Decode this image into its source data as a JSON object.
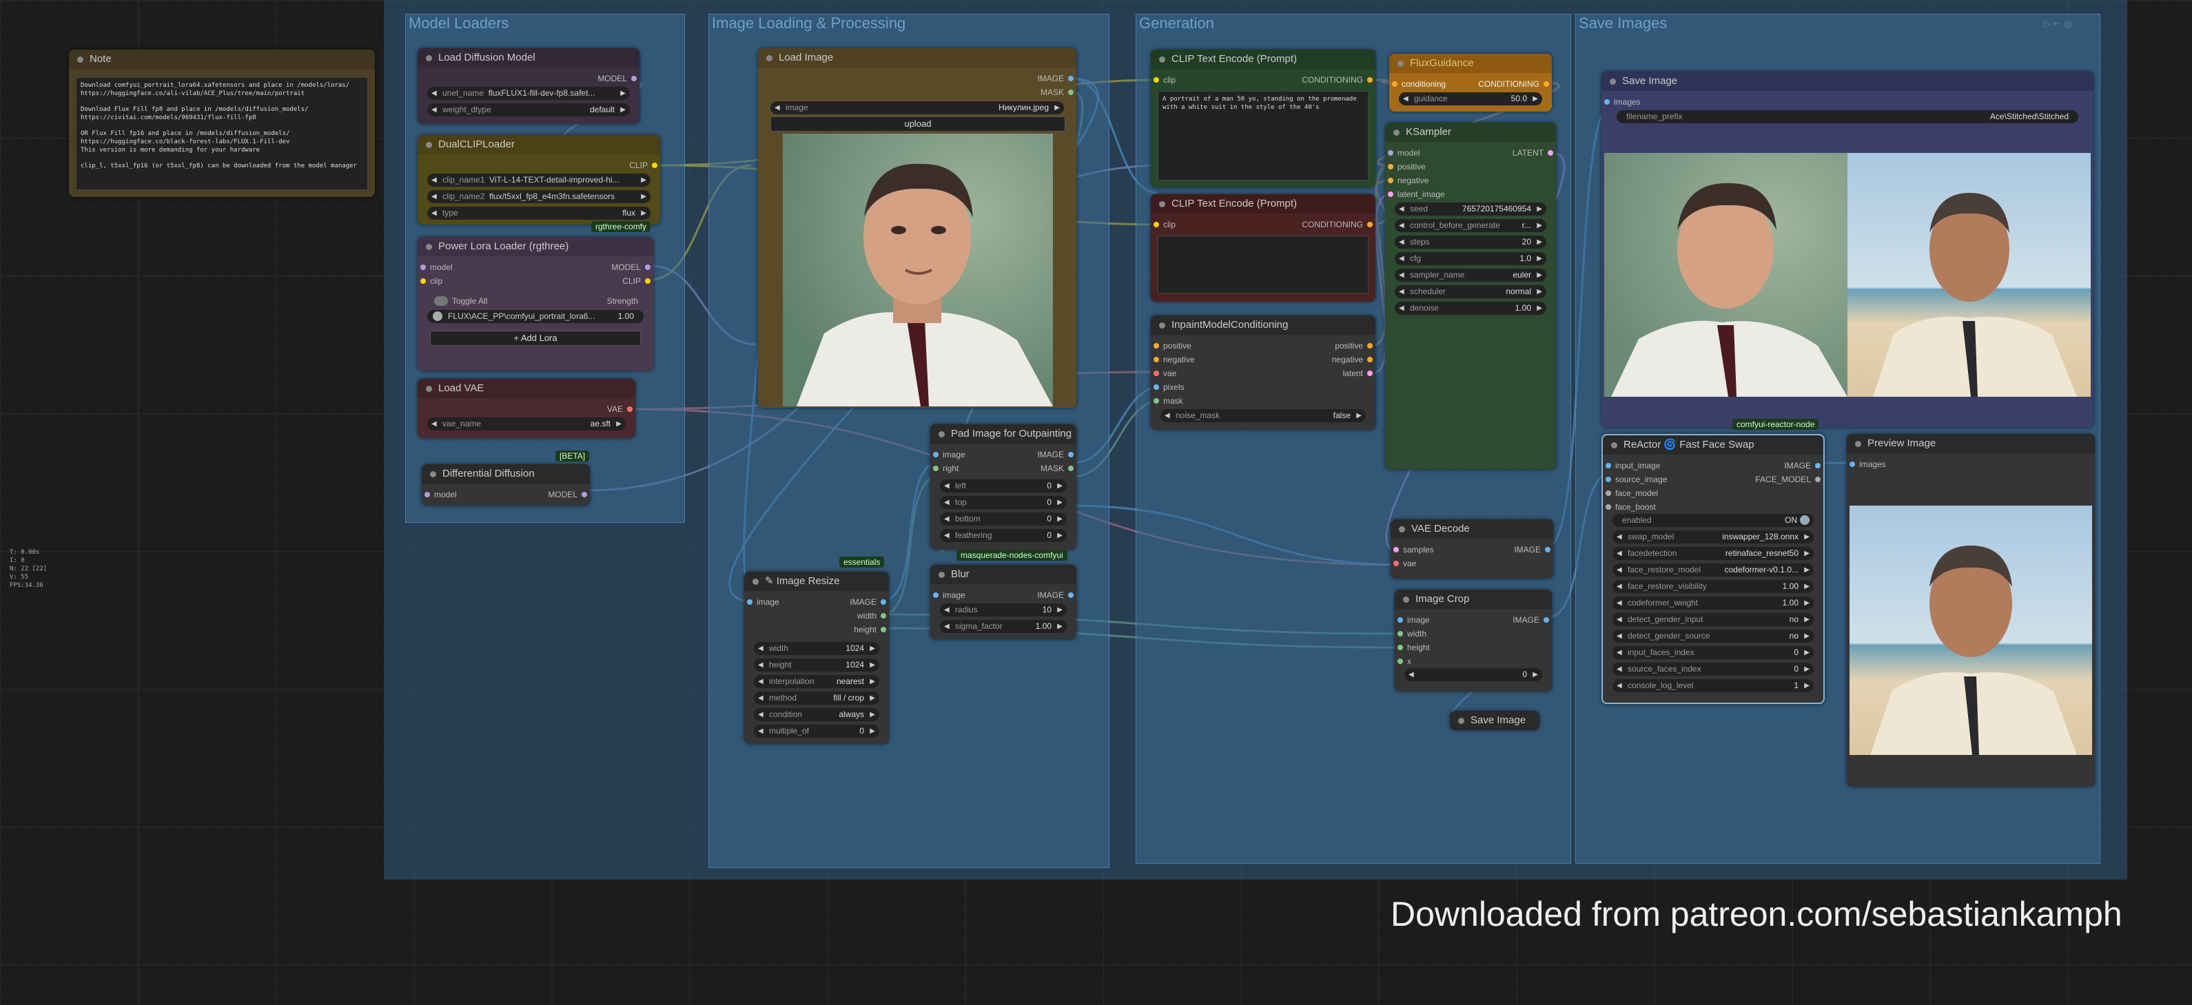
{
  "groups": {
    "model_loaders": "Model Loaders",
    "image_loading": "Image Loading & Processing",
    "generation": "Generation",
    "save_images": "Save Images"
  },
  "note": {
    "title": "Note",
    "text": "Download comfyui_portrait_lora64.safetensors and place in /models/loras/\nhttps://huggingface.co/ali-vilab/ACE_Plus/tree/main/portrait\n\nDownload Flux Fill fp8 and place in /models/diffusion_models/\nhttps://civitai.com/models/969431/flux-fill-fp8\n\nOR Flux Fill fp16 and place in /models/diffusion_models/\nhttps://huggingface.co/black-forest-labs/FLUX.1-Fill-dev\nThis version is more demanding for your hardware\n\nclip_l, t5xxl_fp16 (or t5xxl_fp8) can be downloaded from the model manager"
  },
  "load_diffusion": {
    "title": "Load Diffusion Model",
    "out_model": "MODEL",
    "unet_name_label": "unet_name",
    "unet_name": "fluxFLUX1-fill-dev-fp8.safet...",
    "weight_dtype_label": "weight_dtype",
    "weight_dtype": "default"
  },
  "dual_clip": {
    "title": "DualCLIPLoader",
    "out_clip": "CLIP",
    "clip_name1_label": "clip_name1",
    "clip_name1": "ViT-L-14-TEXT-detail-improved-hi...",
    "clip_name2_label": "clip_name2",
    "clip_name2": "flux/t5xxl_fp8_e4m3fn.safetensors",
    "type_label": "type",
    "type": "flux",
    "tag": "rgthree-comfy"
  },
  "power_lora": {
    "title": "Power Lora Loader (rgthree)",
    "in_model": "model",
    "in_clip": "clip",
    "out_model": "MODEL",
    "out_clip": "CLIP",
    "toggle_all": "Toggle All",
    "strength": "Strength",
    "lora_name": "FLUX\\ACE_PP\\comfyui_portrait_lora6...",
    "lora_strength": "1.00",
    "add_lora": "Add Lora"
  },
  "load_vae": {
    "title": "Load VAE",
    "out_vae": "VAE",
    "vae_name_label": "vae_name",
    "vae_name": "ae.sft"
  },
  "diff_diffusion": {
    "title": "Differential Diffusion",
    "tag": "[BETA]",
    "in_model": "model",
    "out_model": "MODEL"
  },
  "load_image": {
    "title": "Load Image",
    "out_image": "IMAGE",
    "out_mask": "MASK",
    "image_label": "image",
    "image": "Никулин.jpeg",
    "upload": "upload"
  },
  "pad_image": {
    "title": "Pad Image for Outpainting",
    "in_image": "image",
    "in_right": "right",
    "out_image": "IMAGE",
    "out_mask": "MASK",
    "fields": [
      {
        "label": "left",
        "value": "0"
      },
      {
        "label": "top",
        "value": "0"
      },
      {
        "label": "bottom",
        "value": "0"
      },
      {
        "label": "feathering",
        "value": "0"
      }
    ],
    "tag": "masquerade-nodes-comfyui"
  },
  "image_resize": {
    "title": "Image Resize",
    "tag": "essentials",
    "in_image": "image",
    "out_image": "IMAGE",
    "out_width": "width",
    "out_height": "height",
    "fields": [
      {
        "label": "width",
        "value": "1024"
      },
      {
        "label": "height",
        "value": "1024"
      },
      {
        "label": "interpolation",
        "value": "nearest"
      },
      {
        "label": "method",
        "value": "fill / crop"
      },
      {
        "label": "condition",
        "value": "always"
      },
      {
        "label": "multiple_of",
        "value": "0"
      }
    ]
  },
  "blur": {
    "title": "Blur",
    "in_image": "image",
    "out_image": "IMAGE",
    "radius_label": "radius",
    "radius": "10",
    "sigma_label": "sigma_factor",
    "sigma": "1.00"
  },
  "clip_pos": {
    "title": "CLIP Text Encode (Prompt)",
    "in_clip": "clip",
    "out": "CONDITIONING",
    "text": "A portrait of a man 50 yo, standing on the promenade with a white suit in the style of the 40's"
  },
  "clip_neg": {
    "title": "CLIP Text Encode (Prompt)",
    "in_clip": "clip",
    "out": "CONDITIONING",
    "text": ""
  },
  "flux_guidance": {
    "title": "FluxGuidance",
    "in": "conditioning",
    "out": "CONDITIONING",
    "guidance_label": "guidance",
    "guidance": "50.0"
  },
  "inpaint_cond": {
    "title": "InpaintModelConditioning",
    "inputs": [
      "positive",
      "negative",
      "vae",
      "pixels",
      "mask"
    ],
    "outputs": [
      "positive",
      "negative",
      "latent"
    ],
    "noise_mask_label": "noise_mask",
    "noise_mask": "false"
  },
  "ksampler": {
    "title": "KSampler",
    "inputs": [
      "model",
      "positive",
      "negative",
      "latent_image"
    ],
    "out": "LATENT",
    "fields": [
      {
        "label": "seed",
        "value": "765720175460954"
      },
      {
        "label": "control_before_generate",
        "value": "r..."
      },
      {
        "label": "steps",
        "value": "20"
      },
      {
        "label": "cfg",
        "value": "1.0"
      },
      {
        "label": "sampler_name",
        "value": "euler"
      },
      {
        "label": "scheduler",
        "value": "normal"
      },
      {
        "label": "denoise",
        "value": "1.00"
      }
    ]
  },
  "vae_decode": {
    "title": "VAE Decode",
    "in_samples": "samples",
    "in_vae": "vae",
    "out": "IMAGE"
  },
  "image_crop": {
    "title": "Image Crop",
    "inputs": [
      "image",
      "width",
      "height",
      "x"
    ],
    "out": "IMAGE",
    "y_value": "0"
  },
  "save_image_small": {
    "title": "Save Image"
  },
  "save_image": {
    "title": "Save Image",
    "in_images": "images",
    "prefix_label": "filename_prefix",
    "prefix": "Ace\\Stitched\\Stitched"
  },
  "reactor": {
    "title": "ReActor 🌀 Fast Face Swap",
    "tag": "comfyui-reactor-node",
    "inputs": [
      "input_image",
      "source_image",
      "face_model",
      "face_boost"
    ],
    "out_image": "IMAGE",
    "out_face_model": "FACE_MODEL",
    "enabled_label": "enabled",
    "enabled": "ON",
    "fields": [
      {
        "label": "swap_model",
        "value": "inswapper_128.onnx"
      },
      {
        "label": "facedetection",
        "value": "retinaface_resnet50"
      },
      {
        "label": "face_restore_model",
        "value": "codeformer-v0.1.0..."
      },
      {
        "label": "face_restore_visibility",
        "value": "1.00"
      },
      {
        "label": "codeformer_weight",
        "value": "1.00"
      },
      {
        "label": "detect_gender_input",
        "value": "no"
      },
      {
        "label": "detect_gender_source",
        "value": "no"
      },
      {
        "label": "input_faces_index",
        "value": "0"
      },
      {
        "label": "source_faces_index",
        "value": "0"
      },
      {
        "label": "console_log_level",
        "value": "1"
      }
    ]
  },
  "preview": {
    "title": "Preview Image",
    "in_images": "images"
  },
  "watermark": "Downloaded from patreon.com/sebastiankamph",
  "stats": "T: 0.00s\nI: 0\nN: 22 [22]\nV: 55\nFPS:34.36",
  "colors": {
    "model": "#b39ddb",
    "clip": "#ffd500",
    "vae": "#ff6e6e",
    "image": "#64b5f6",
    "mask": "#81c784",
    "conditioning": "#ffa931",
    "latent": "#ff9cf9"
  }
}
